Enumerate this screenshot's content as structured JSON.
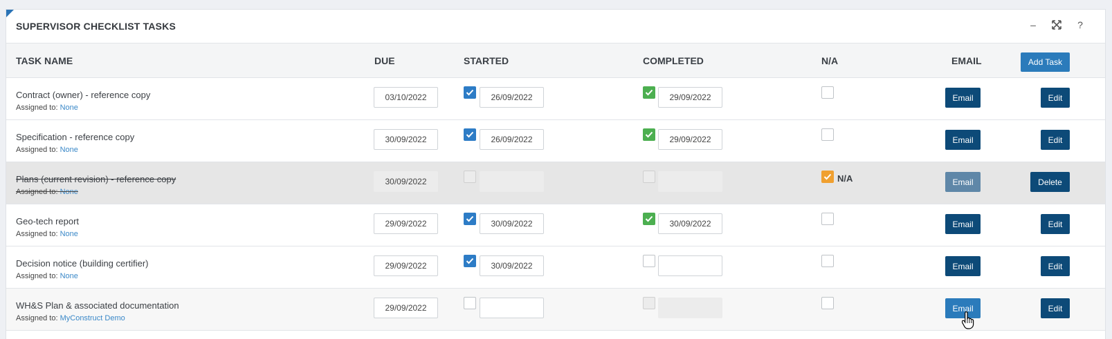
{
  "panel": {
    "title": "SUPERVISOR CHECKLIST TASKS",
    "tools": {
      "minimize": "–",
      "expand": "⤧",
      "help": "?"
    }
  },
  "columns": {
    "task_name": "TASK NAME",
    "due": "DUE",
    "started": "STARTED",
    "completed": "COMPLETED",
    "na": "N/A",
    "email": "EMAIL"
  },
  "add_task_label": "Add Task",
  "assigned_prefix": "Assigned to: ",
  "colors": {
    "accent": "#2d7cc6",
    "dark_button": "#0d4a78",
    "complete_green": "#4caf50",
    "na_orange": "#f0a030",
    "link": "#3a88c8"
  },
  "rows": [
    {
      "name": "Contract (owner) - reference copy",
      "assigned": "None",
      "due": "03/10/2022",
      "started_checked": true,
      "started": "26/09/2022",
      "completed_checked": true,
      "completed": "29/09/2022",
      "na_checked": false,
      "email_label": "Email",
      "action_label": "Edit"
    },
    {
      "name": "Specification - reference copy",
      "assigned": "None",
      "due": "30/09/2022",
      "started_checked": true,
      "started": "26/09/2022",
      "completed_checked": true,
      "completed": "29/09/2022",
      "na_checked": false,
      "email_label": "Email",
      "action_label": "Edit"
    },
    {
      "name": "Plans (current revision) - reference copy",
      "assigned": "None",
      "due": "30/09/2022",
      "started_checked": false,
      "started": "",
      "completed_checked": false,
      "completed": "",
      "na_checked": true,
      "na_label": "N/A",
      "email_label": "Email",
      "action_label": "Delete"
    },
    {
      "name": "Geo-tech report",
      "assigned": "None",
      "due": "29/09/2022",
      "started_checked": true,
      "started": "30/09/2022",
      "completed_checked": true,
      "completed": "30/09/2022",
      "na_checked": false,
      "email_label": "Email",
      "action_label": "Edit"
    },
    {
      "name": "Decision notice (building certifier)",
      "assigned": "None",
      "due": "29/09/2022",
      "started_checked": true,
      "started": "30/09/2022",
      "completed_checked": false,
      "completed": "",
      "na_checked": false,
      "email_label": "Email",
      "action_label": "Edit"
    },
    {
      "name": "WH&S Plan & associated documentation",
      "assigned": "MyConstruct Demo",
      "due": "29/09/2022",
      "started_checked": false,
      "started": "",
      "completed_checked": false,
      "completed": "",
      "na_checked": false,
      "email_label": "Email",
      "action_label": "Edit"
    }
  ]
}
